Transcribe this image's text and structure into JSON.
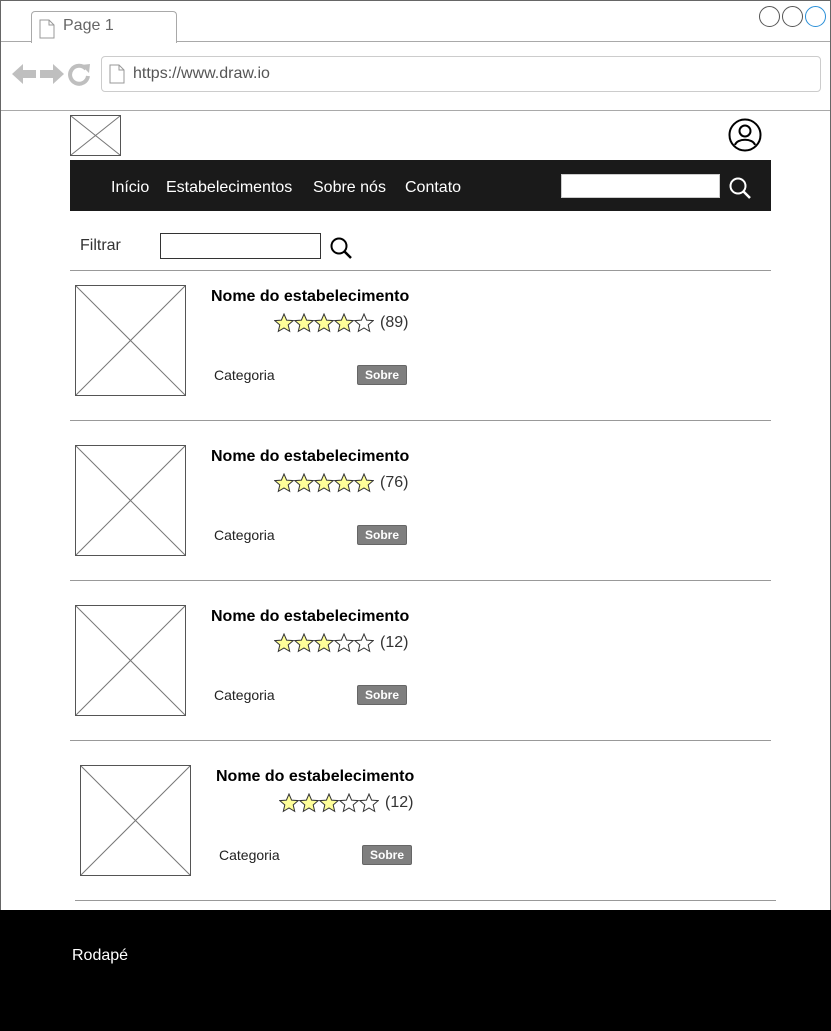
{
  "browser": {
    "tab_title": "Page 1",
    "url": "https://www.draw.io"
  },
  "header": {
    "menu": [
      "Início",
      "Estabelecimentos",
      "Sobre nós",
      "Contato"
    ],
    "search_value": ""
  },
  "filter": {
    "label": "Filtrar",
    "value": ""
  },
  "establishments": [
    {
      "name": "Nome do estabelecimento",
      "rating": 4,
      "max_rating": 5,
      "count": "(89)",
      "category": "Categoria",
      "button": "Sobre"
    },
    {
      "name": "Nome do estabelecimento",
      "rating": 5,
      "max_rating": 5,
      "count": "(76)",
      "category": "Categoria",
      "button": "Sobre"
    },
    {
      "name": "Nome do estabelecimento",
      "rating": 3,
      "max_rating": 5,
      "count": "(12)",
      "category": "Categoria",
      "button": "Sobre"
    },
    {
      "name": "Nome do estabelecimento",
      "rating": 3,
      "max_rating": 5,
      "count": "(12)",
      "category": "Categoria",
      "button": "Sobre"
    }
  ],
  "footer": {
    "text": "Rodapé"
  },
  "colors": {
    "menu_bg": "#1a1a1a",
    "star_fill": "#ffff99",
    "button_bg": "#7f7f7f",
    "footer_bg": "#000000"
  }
}
